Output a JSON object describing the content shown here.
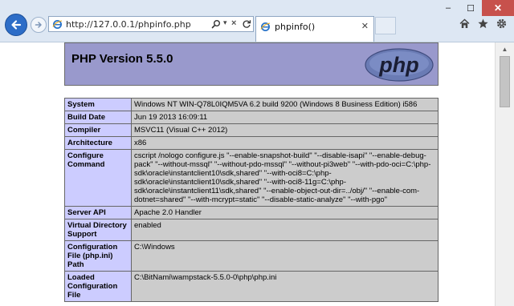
{
  "browser": {
    "address_url": "http://127.0.0.1/phpinfo.php",
    "tab_title": "phpinfo()",
    "window_buttons": {
      "minimize": "–",
      "maximize": "☐",
      "close": "✕"
    }
  },
  "page": {
    "php_version_heading": "PHP Version 5.5.0",
    "logo_text": "php",
    "rows": [
      {
        "key": "System",
        "value": "Windows NT WIN-Q78L0IQM5VA 6.2 build 9200 (Windows 8 Business Edition) i586"
      },
      {
        "key": "Build Date",
        "value": "Jun 19 2013 16:09:11"
      },
      {
        "key": "Compiler",
        "value": "MSVC11 (Visual C++ 2012)"
      },
      {
        "key": "Architecture",
        "value": "x86"
      },
      {
        "key": "Configure Command",
        "value": "cscript /nologo configure.js \"--enable-snapshot-build\" \"--disable-isapi\" \"--enable-debug-pack\" \"--without-mssql\" \"--without-pdo-mssql\" \"--without-pi3web\" \"--with-pdo-oci=C:\\php-sdk\\oracle\\instantclient10\\sdk,shared\" \"--with-oci8=C:\\php-sdk\\oracle\\instantclient10\\sdk,shared\" \"--with-oci8-11g=C:\\php-sdk\\oracle\\instantclient11\\sdk,shared\" \"--enable-object-out-dir=../obj/\" \"--enable-com-dotnet=shared\" \"--with-mcrypt=static\" \"--disable-static-analyze\" \"--with-pgo\""
      },
      {
        "key": "Server API",
        "value": "Apache 2.0 Handler"
      },
      {
        "key": "Virtual Directory Support",
        "value": "enabled"
      },
      {
        "key": "Configuration File (php.ini) Path",
        "value": "C:\\Windows"
      },
      {
        "key": "Loaded Configuration File",
        "value": "C:\\BitNami\\wampstack-5.5.0-0\\php\\php.ini"
      }
    ]
  },
  "colors": {
    "header_bg": "#9999cc",
    "key_cell_bg": "#ccccff",
    "value_cell_bg": "#cccccc",
    "back_button": "#2d6dc7",
    "close_button": "#c7514c"
  },
  "icons": [
    "back-arrow-icon",
    "forward-arrow-icon",
    "ie-page-icon",
    "search-icon",
    "dropdown-icon",
    "stop-icon",
    "refresh-icon",
    "home-icon",
    "favorites-star-icon",
    "tools-gear-icon"
  ]
}
